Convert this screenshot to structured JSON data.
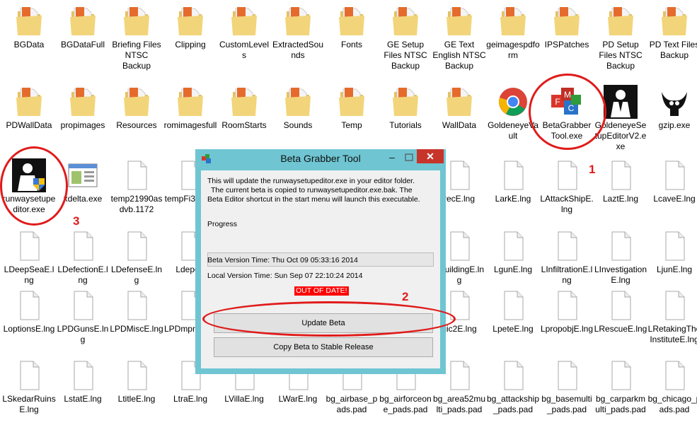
{
  "desktop": {
    "row1": [
      {
        "label": "BGData",
        "icon": "folder-icon"
      },
      {
        "label": "BGDataFull",
        "icon": "folder-icon"
      },
      {
        "label": "Briefing Files NTSC Backup",
        "icon": "folder-icon"
      },
      {
        "label": "Clipping",
        "icon": "folder-icon"
      },
      {
        "label": "CustomLevels",
        "icon": "folder-icon"
      },
      {
        "label": "ExtractedSounds",
        "icon": "folder-icon"
      },
      {
        "label": "Fonts",
        "icon": "folder-icon"
      },
      {
        "label": "GE Setup Files NTSC Backup",
        "icon": "folder-icon"
      },
      {
        "label": "GE Text English NTSC Backup",
        "icon": "folder-icon"
      },
      {
        "label": "geimagespdform",
        "icon": "folder-icon"
      },
      {
        "label": "IPSPatches",
        "icon": "folder-icon"
      },
      {
        "label": "PD Setup Files NTSC Backup",
        "icon": "folder-icon"
      },
      {
        "label": "PD Text Files Backup",
        "icon": "folder-icon"
      }
    ],
    "row2": [
      {
        "label": "PDWallData",
        "icon": "folder-icon"
      },
      {
        "label": "propimages",
        "icon": "folder-icon"
      },
      {
        "label": "Resources",
        "icon": "folder-icon"
      },
      {
        "label": "romimagesfull",
        "icon": "folder-icon"
      },
      {
        "label": "RoomStarts",
        "icon": "folder-icon"
      },
      {
        "label": "Sounds",
        "icon": "folder-icon"
      },
      {
        "label": "Temp",
        "icon": "folder-icon"
      },
      {
        "label": "Tutorials",
        "icon": "folder-icon"
      },
      {
        "label": "WallData",
        "icon": "folder-icon"
      },
      {
        "label": "GoldeneyeVault",
        "icon": "chrome-icon"
      },
      {
        "label": "BetaGrabberTool.exe",
        "icon": "mfc-app-icon"
      },
      {
        "label": "GoldeneyeSetupEditorV2.exe",
        "icon": "agent-silhouette-icon"
      },
      {
        "label": "gzip.exe",
        "icon": "gzip-icon"
      }
    ],
    "row3": [
      {
        "label": "runwaysetupeditor.exe",
        "icon": "agent-shield-icon"
      },
      {
        "label": "xdelta.exe",
        "icon": "window-app-icon"
      },
      {
        "label": "temp21990asdvb.1172",
        "icon": "file-icon"
      },
      {
        "label": "tempFi34ax.1",
        "icon": "file-icon"
      },
      {
        "label": "recE.lng",
        "icon": "file-icon"
      },
      {
        "label": "LarkE.lng",
        "icon": "file-icon"
      },
      {
        "label": "LAttackShipE.lng",
        "icon": "file-icon"
      },
      {
        "label": "LaztE.lng",
        "icon": "file-icon"
      },
      {
        "label": "LcaveE.lng",
        "icon": "file-icon"
      }
    ],
    "row4": [
      {
        "label": "LDeepSeaE.lng",
        "icon": "file-icon"
      },
      {
        "label": "LDefectionE.lng",
        "icon": "file-icon"
      },
      {
        "label": "LDefenseE.lng",
        "icon": "file-icon"
      },
      {
        "label": "LdepoE",
        "icon": "file-icon"
      },
      {
        "label": "5BuildingE.lng",
        "icon": "file-icon"
      },
      {
        "label": "LgunE.lng",
        "icon": "file-icon"
      },
      {
        "label": "LInfiltrationE.lng",
        "icon": "file-icon"
      },
      {
        "label": "LInvestigationE.lng",
        "icon": "file-icon"
      },
      {
        "label": "LjunE.lng",
        "icon": "file-icon"
      }
    ],
    "row5": [
      {
        "label": "LoptionsE.lng",
        "icon": "file-icon"
      },
      {
        "label": "LPDGunsE.lng",
        "icon": "file-icon"
      },
      {
        "label": "LPDMiscE.lng",
        "icon": "file-icon"
      },
      {
        "label": "LPDmpnuE.ln",
        "icon": "file-icon"
      },
      {
        "label": "gic2E.lng",
        "icon": "file-icon"
      },
      {
        "label": "LpeteE.lng",
        "icon": "file-icon"
      },
      {
        "label": "LpropobjE.lng",
        "icon": "file-icon"
      },
      {
        "label": "LRescueE.lng",
        "icon": "file-icon"
      },
      {
        "label": "LRetakingTheInstituteE.lng",
        "icon": "file-icon"
      }
    ],
    "row6": [
      {
        "label": "LSkedarRuinsE.lng",
        "icon": "file-icon"
      },
      {
        "label": "LstatE.lng",
        "icon": "file-icon"
      },
      {
        "label": "LtitleE.lng",
        "icon": "file-icon"
      },
      {
        "label": "LtraE.lng",
        "icon": "file-icon"
      },
      {
        "label": "LVillaE.lng",
        "icon": "file-icon"
      },
      {
        "label": "LWarE.lng",
        "icon": "file-icon"
      },
      {
        "label": "bg_airbase_pads.pad",
        "icon": "file-icon"
      },
      {
        "label": "bg_airforceone_pads.pad",
        "icon": "file-icon"
      },
      {
        "label": "bg_area52multi_pads.pad",
        "icon": "file-icon"
      },
      {
        "label": "bg_attackship_pads.pad",
        "icon": "file-icon"
      },
      {
        "label": "bg_basemulti_pads.pad",
        "icon": "file-icon"
      },
      {
        "label": "bg_carparkmulti_pads.pad",
        "icon": "file-icon"
      },
      {
        "label": "bg_chicago_pads.pad",
        "icon": "file-icon"
      }
    ]
  },
  "dialog": {
    "title": "Beta Grabber Tool",
    "minimize": "–",
    "close": "✕",
    "description": [
      "This will update the runwaysetupeditor.exe in your editor folder.",
      "The current beta is copied to runwaysetupeditor.exe.bak.  The",
      "Beta Editor shortcut in the start menu will launch this executable."
    ],
    "progress_label": "Progress",
    "progress": 0,
    "beta_version": "Beta Version Time: Thu Oct 09 05:33:16 2014",
    "local_version": "Local Version Time: Sun Sep 07 22:10:24 2014",
    "status": "OUT OF DATE!",
    "update_button": "Update Beta",
    "copy_button": "Copy Beta to Stable Release"
  },
  "annotations": {
    "n1": "1",
    "n2": "2",
    "n3": "3",
    "color": "#e01b1b"
  },
  "colors": {
    "dialog_frame": "#6fc5d2",
    "close_button": "#c7342a",
    "status_bg": "#ff0000"
  }
}
